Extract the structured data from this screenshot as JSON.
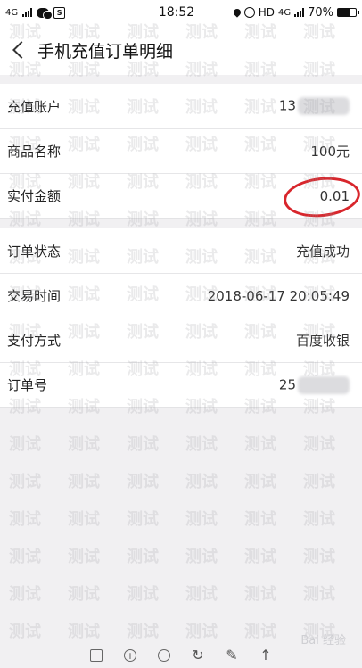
{
  "status_bar": {
    "network": "4G",
    "time": "18:52",
    "hd_label": "HD",
    "network_right": "4G",
    "battery_percent": "70%",
    "battery_level": 0.7
  },
  "header": {
    "title": "手机充值订单明细"
  },
  "group1": [
    {
      "label": "充值账户",
      "value": "13"
    },
    {
      "label": "商品名称",
      "value": "100元"
    },
    {
      "label": "实付金额",
      "value": "0.01"
    }
  ],
  "group2": [
    {
      "label": "订单状态",
      "value": "充值成功"
    },
    {
      "label": "交易时间",
      "value": "2018-06-17 20:05:49"
    },
    {
      "label": "支付方式",
      "value": "百度收银"
    },
    {
      "label": "订单号",
      "value": "25"
    }
  ],
  "watermark_text": "测试",
  "brand_text": "Bai 经验"
}
